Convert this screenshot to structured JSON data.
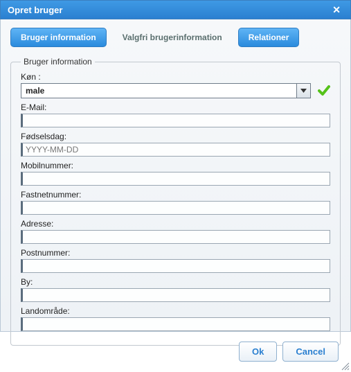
{
  "dialog": {
    "title": "Opret bruger"
  },
  "tabs": {
    "user_info": "Bruger information",
    "optional_info": "Valgfri brugerinformation",
    "relations": "Relationer"
  },
  "group": {
    "legend": "Bruger information"
  },
  "fields": {
    "gender": {
      "label": "Køn :",
      "value": "male"
    },
    "email": {
      "label": "E-Mail:",
      "value": ""
    },
    "birthday": {
      "label": "Fødselsdag:",
      "value": "",
      "placeholder": "YYYY-MM-DD"
    },
    "mobile": {
      "label": "Mobilnummer:",
      "value": ""
    },
    "landline": {
      "label": "Fastnetnummer:",
      "value": ""
    },
    "address": {
      "label": "Adresse:",
      "value": ""
    },
    "postal": {
      "label": "Postnummer:",
      "value": ""
    },
    "city": {
      "label": "By:",
      "value": ""
    },
    "region": {
      "label": "Landområde:",
      "value": ""
    }
  },
  "buttons": {
    "ok": "Ok",
    "cancel": "Cancel"
  }
}
